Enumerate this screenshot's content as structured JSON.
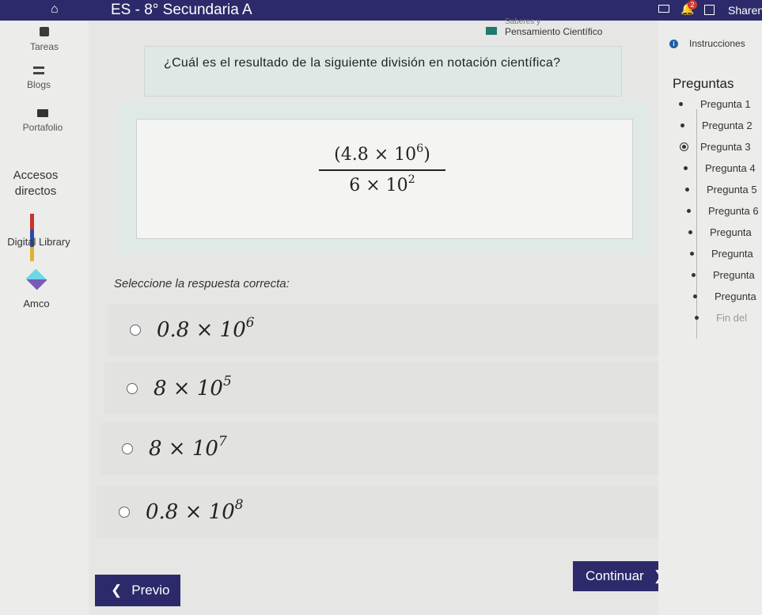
{
  "topbar": {
    "title": "ES - 8° Secundaria A",
    "share_label": "Sharen",
    "notification_count": "2",
    "icons": [
      "home-icon",
      "mail-icon",
      "bell-icon",
      "calendar-icon"
    ]
  },
  "sidebar": {
    "items": [
      {
        "label": "Tareas",
        "icon": "tasks-icon"
      },
      {
        "label": "Blogs",
        "icon": "blog-icon"
      },
      {
        "label": "Portafolio",
        "icon": "portfolio-icon"
      },
      {
        "label": "Accesos directos"
      },
      {
        "label": "Digital Library",
        "icon": "books-icon"
      },
      {
        "label": "Amco",
        "icon": "cube-icon"
      }
    ]
  },
  "subject": {
    "line1": "Saberes y",
    "line2": "Pensamiento Científico"
  },
  "question": {
    "text": "¿Cuál es el resultado de la siguiente división en notación científica?",
    "formula_numerator": "(4.8 × 10",
    "formula_numerator_exp": "6",
    "formula_numerator_close": ")",
    "formula_denominator": "6 × 10",
    "formula_denominator_exp": "2"
  },
  "prompt": "Seleccione la respuesta correcta:",
  "options": [
    {
      "base": "0.8 × 10",
      "exp": "6"
    },
    {
      "base": "8 × 10",
      "exp": "5"
    },
    {
      "base": "8 × 10",
      "exp": "7"
    },
    {
      "base": "0.8 × 10",
      "exp": "8"
    }
  ],
  "nav": {
    "prev_label": "Previo",
    "next_label": "Continuar",
    "prev_icon": "chevron-left-icon",
    "next_icon": "chevron-right-icon"
  },
  "right_panel": {
    "instructions_label": "Instrucciones",
    "heading": "Preguntas",
    "items": [
      "Pregunta 1",
      "Pregunta 2",
      "Pregunta 3",
      "Pregunta 4",
      "Pregunta 5",
      "Pregunta 6",
      "Pregunta",
      "Pregunta",
      "Pregunta",
      "Pregunta",
      "Fin del"
    ],
    "current_index": 2
  },
  "colors": {
    "topbar": "#2d2a6b",
    "question_bg": "#dfe8e4",
    "button_bg": "#2d2a6b",
    "subject_icon": "#1e7a6e"
  }
}
